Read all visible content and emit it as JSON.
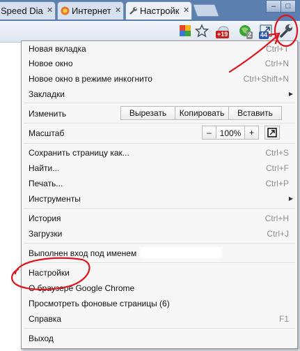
{
  "tabs": [
    {
      "title": "Speed Dia",
      "close": "✕"
    },
    {
      "title": "Интернет",
      "close": "✕"
    },
    {
      "title": "Настройк",
      "close": "✕"
    }
  ],
  "window_controls": {
    "minimize": "–",
    "maximize": "□"
  },
  "toolbar": {
    "badges": {
      "plus": "+19",
      "count2": "2",
      "count44": "44"
    }
  },
  "menu": {
    "new_tab": {
      "label": "Новая вкладка",
      "shortcut": "Ctrl+T"
    },
    "new_window": {
      "label": "Новое окно",
      "shortcut": "Ctrl+N"
    },
    "incognito": {
      "label": "Новое окно в режиме инкогнито",
      "shortcut": "Ctrl+Shift+N"
    },
    "bookmarks": {
      "label": "Закладки",
      "arrow": "▶"
    },
    "edit": {
      "label": "Изменить",
      "cut": "Вырезать",
      "copy": "Копировать",
      "paste": "Вставить"
    },
    "zoom": {
      "label": "Масштаб",
      "minus": "–",
      "value": "100%",
      "plus": "+"
    },
    "save_page": {
      "label": "Сохранить страницу как...",
      "shortcut": "Ctrl+S"
    },
    "find": {
      "label": "Найти...",
      "shortcut": "Ctrl+F"
    },
    "print": {
      "label": "Печать...",
      "shortcut": "Ctrl+P"
    },
    "tools": {
      "label": "Инструменты",
      "arrow": "▶"
    },
    "history": {
      "label": "История",
      "shortcut": "Ctrl+H"
    },
    "downloads": {
      "label": "Загрузки",
      "shortcut": "Ctrl+J"
    },
    "signed_in": {
      "label": "Выполнен вход под именем"
    },
    "settings": {
      "label": "Настройки"
    },
    "about": {
      "label": "О браузере Google Chrome"
    },
    "background_pages": {
      "label": "Просмотреть фоновые страницы (6)"
    },
    "help": {
      "label": "Справка",
      "shortcut": "F1"
    },
    "exit": {
      "label": "Выход"
    }
  },
  "colors": {
    "annotation": "#e0141e",
    "tabstrip": "#5b7fae"
  }
}
